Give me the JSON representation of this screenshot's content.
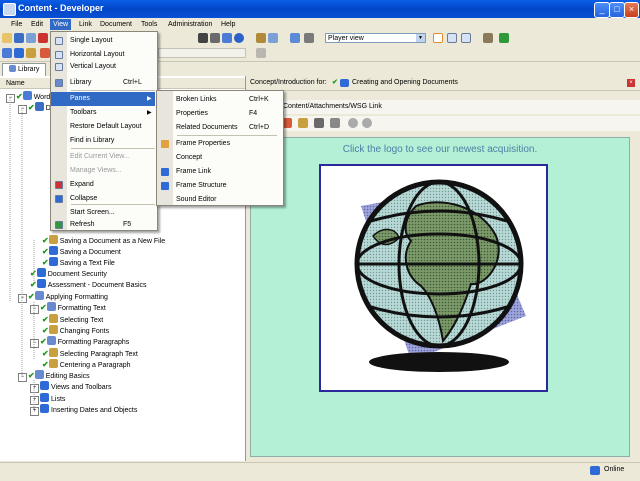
{
  "window": {
    "title": "Content - Developer"
  },
  "menubar": [
    "File",
    "Edit",
    "View",
    "Link",
    "Document",
    "Tools",
    "Administration",
    "Help"
  ],
  "toolbar": {
    "player_view": "Player view"
  },
  "left": {
    "tab": "Library",
    "column_name": "Name",
    "tree": [
      {
        "label": "Word",
        "indent": 0
      },
      {
        "label": "D",
        "indent": 1
      },
      {
        "label": "Saving a Document as a New File",
        "indent": 3
      },
      {
        "label": "Saving a Document",
        "indent": 3
      },
      {
        "label": "Saving a Text File",
        "indent": 3
      },
      {
        "label": "Document Security",
        "indent": 2
      },
      {
        "label": "Assessment - Document Basics",
        "indent": 2
      },
      {
        "label": "Applying Formatting",
        "indent": 1
      },
      {
        "label": "Formatting Text",
        "indent": 2
      },
      {
        "label": "Selecting Text",
        "indent": 3
      },
      {
        "label": "Changing Fonts",
        "indent": 3
      },
      {
        "label": "Formatting Paragraphs",
        "indent": 2
      },
      {
        "label": "Selecting Paragraph Text",
        "indent": 3
      },
      {
        "label": "Centering a Paragraph",
        "indent": 3
      },
      {
        "label": "Editing Basics",
        "indent": 1
      },
      {
        "label": "Views and Toolbars",
        "indent": 2
      },
      {
        "label": "Lists",
        "indent": 2
      },
      {
        "label": "Inserting Dates and Objects",
        "indent": 2
      }
    ]
  },
  "right": {
    "concept_prefix": "Concept/Introduction for:",
    "concept_doc": "Creating and Opening Documents",
    "link_path": "Content/Attachments/WSG Link",
    "acquisition_text": "Click the logo to see our newest acquisition."
  },
  "view_menu": [
    {
      "label": "Single Layout",
      "shortcut": "",
      "disabled": false
    },
    {
      "label": "Horizontal Layout",
      "shortcut": "",
      "disabled": false
    },
    {
      "label": "Vertical Layout",
      "shortcut": "",
      "disabled": false
    },
    {
      "label": "Library",
      "shortcut": "Ctrl+L",
      "disabled": false
    },
    {
      "label": "Panes",
      "shortcut": "",
      "disabled": false
    },
    {
      "label": "Toolbars",
      "shortcut": "",
      "disabled": false
    },
    {
      "label": "Restore Default Layout",
      "shortcut": "",
      "disabled": false
    },
    {
      "label": "Find in Library",
      "shortcut": "",
      "disabled": false
    },
    {
      "label": "Edit Current View...",
      "shortcut": "",
      "disabled": true
    },
    {
      "label": "Manage Views...",
      "shortcut": "",
      "disabled": true
    },
    {
      "label": "Expand",
      "shortcut": "",
      "disabled": false
    },
    {
      "label": "Collapse",
      "shortcut": "",
      "disabled": false
    },
    {
      "label": "Start Screen...",
      "shortcut": "",
      "disabled": false
    },
    {
      "label": "Refresh",
      "shortcut": "F5",
      "disabled": false
    }
  ],
  "panes_menu": [
    {
      "label": "Broken Links",
      "shortcut": "Ctrl+K"
    },
    {
      "label": "Properties",
      "shortcut": "F4"
    },
    {
      "label": "Related Documents",
      "shortcut": "Ctrl+D"
    },
    {
      "label": "Frame Properties",
      "shortcut": ""
    },
    {
      "label": "Concept",
      "shortcut": ""
    },
    {
      "label": "Frame Link",
      "shortcut": ""
    },
    {
      "label": "Frame Structure",
      "shortcut": ""
    },
    {
      "label": "Sound Editor",
      "shortcut": ""
    }
  ],
  "status": {
    "online": "Online"
  },
  "colors": {
    "highlight": "#316ac5",
    "content_bg": "#b3f0d6",
    "titlebar": "#0a5ee6"
  }
}
